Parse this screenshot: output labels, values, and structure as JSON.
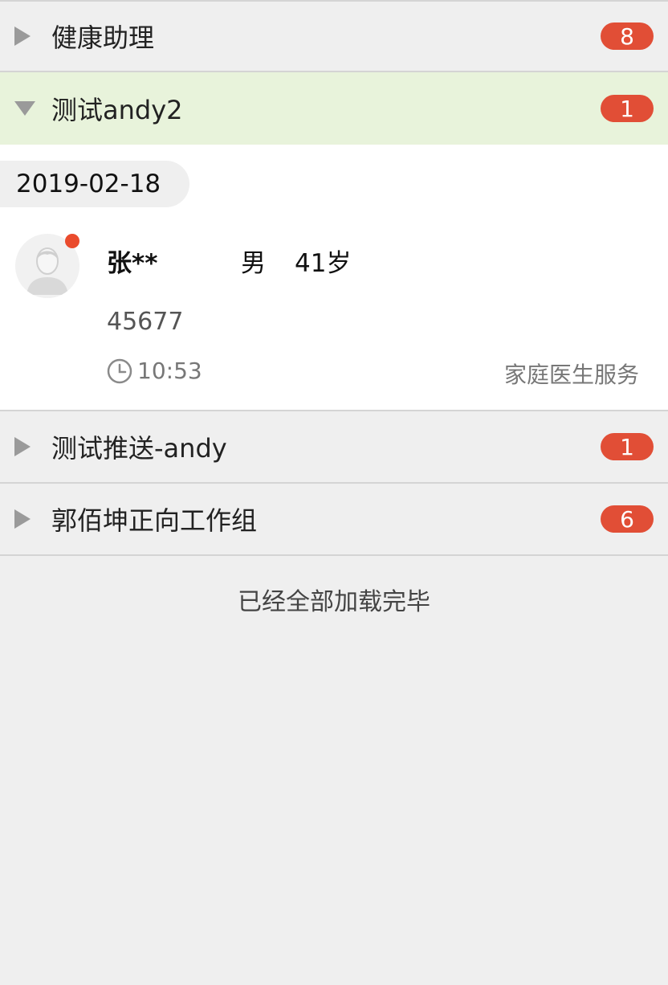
{
  "groups": [
    {
      "title": "健康助理",
      "badge": "8",
      "expanded": false
    },
    {
      "title": "测试andy2",
      "badge": "1",
      "expanded": true
    },
    {
      "title": "测试推送-andy",
      "badge": "1",
      "expanded": false
    },
    {
      "title": "郭佰坤正向工作组",
      "badge": "6",
      "expanded": false
    }
  ],
  "expanded_group": {
    "date": "2019-02-18",
    "patient": {
      "name": "张**",
      "gender": "男",
      "age": "41岁",
      "id": "45677",
      "time": "10:53",
      "service": "家庭医生服务",
      "unread": true
    }
  },
  "footer": {
    "text": "已经全部加载完毕"
  },
  "colors": {
    "badge": "#e14e36",
    "expanded_header": "#e8f3db",
    "unread_dot": "#ea4b2d",
    "background": "#efefef"
  },
  "icons": {
    "collapsed": "triangle-right-icon",
    "expanded": "triangle-down-icon",
    "avatar": "person-avatar-icon",
    "time": "clock-icon"
  }
}
